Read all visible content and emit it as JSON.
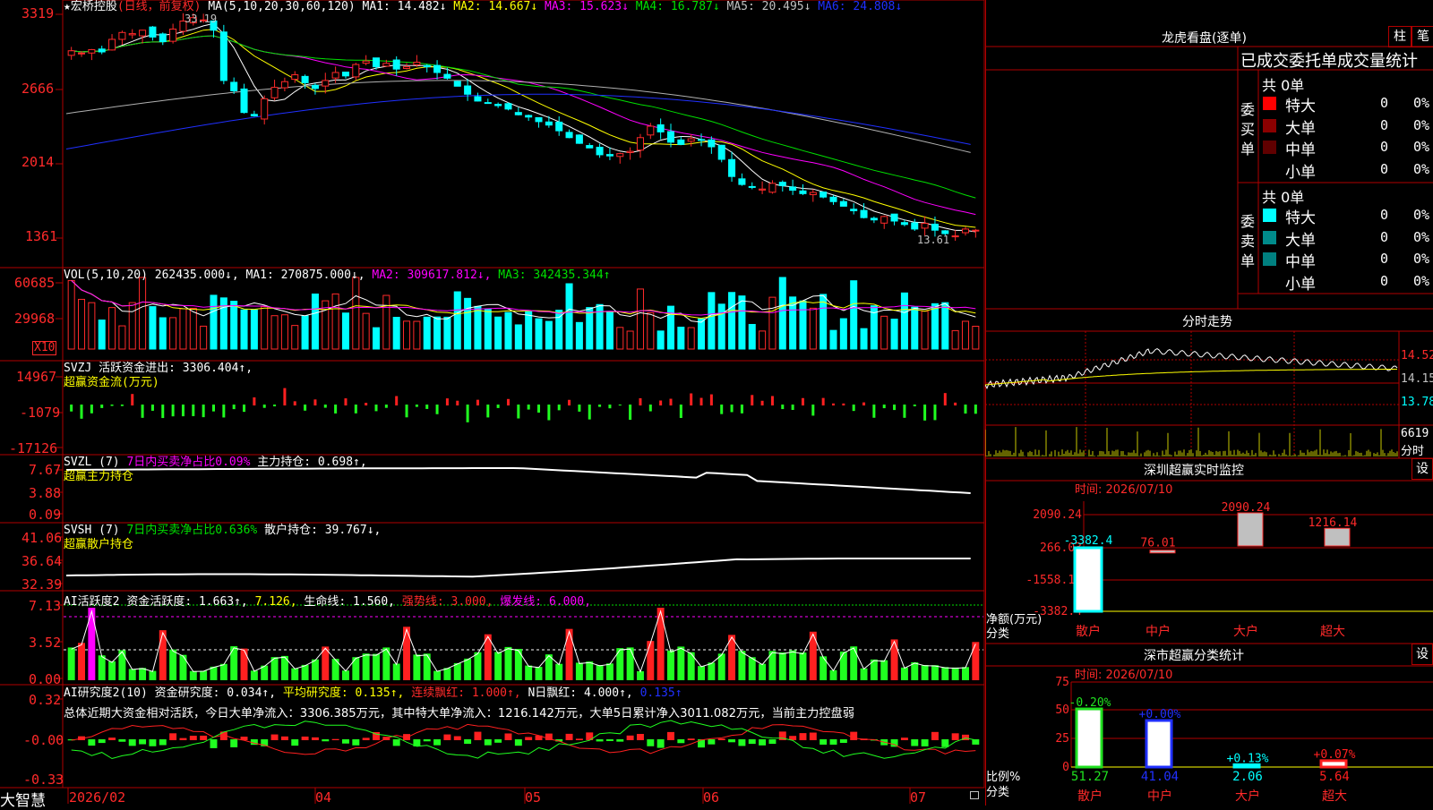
{
  "colors": {
    "up": "#ff2a2a",
    "down": "#00ffff",
    "ma1": "#ffffff",
    "ma2": "#ffff00",
    "ma3": "#ff00ff",
    "ma4": "#00e000",
    "ma5": "#b0b0b0",
    "ma6": "#2030ff",
    "grid": "#b00000",
    "flowUp": "#ff2020",
    "flowDown": "#20ff20"
  },
  "main": {
    "star": "★",
    "name": "宏桥控股",
    "mode": "(日线，前复权)",
    "ma_label": "MA(5,10,20,30,60,120)",
    "ma1": "MA1: 14.482↓",
    "ma2": "MA2: 14.667↓",
    "ma3": "MA3: 15.623↓",
    "ma4": "MA4: 16.787↓",
    "ma5": "MA5: 20.495↓",
    "ma6": "MA6: 24.808↓",
    "high_label": "33.19",
    "low_label": "13.61",
    "yticks": [
      "3319",
      "2666",
      "2014",
      "1361"
    ]
  },
  "vol": {
    "label": "VOL(5,10,20)",
    "value": "262435.000↓,",
    "ma1": "MA1: 270875.000↓,",
    "ma2": "MA2: 309617.812↓,",
    "ma3": "MA3: 342435.344↑",
    "yticks": [
      "60685",
      "29968"
    ],
    "unit": "X10"
  },
  "svzj": {
    "label": "SVZJ",
    "text": "活跃资金进出: 3306.404↑,",
    "sub": "超赢资金流(万元)",
    "yticks": [
      "14967",
      "-1079",
      "-17126"
    ]
  },
  "svzl": {
    "label": "SVZL (7)",
    "a": "7日内买卖净占比0.09%",
    "b": "主力持仓: 0.698↑,",
    "sub": "超赢主力持仓",
    "yticks": [
      "7.67",
      "3.88",
      "0.09"
    ]
  },
  "svsh": {
    "label": "SVSH (7)",
    "a": "7日内买卖净占比0.636%",
    "b": "散户持仓: 39.767↓,",
    "sub": "超赢散户持仓",
    "yticks": [
      "41.06",
      "36.64",
      "32.39"
    ]
  },
  "ai1": {
    "label": "AI活跃度2",
    "a": "资金活跃度: 1.663↑,",
    "b": "7.126,",
    "c": "生命线: 1.560,",
    "d": "强势线: 3.000,",
    "e": "爆发线: 6.000,",
    "yticks": [
      "7.13",
      "3.52",
      "0.00"
    ]
  },
  "ai2": {
    "label": "AI研究度2(10)",
    "a": "资金研究度: 0.034↑,",
    "b": "平均研究度: 0.135↑,",
    "c": "连续飘红: 1.000↑,",
    "d": "N日飘红: 4.000↑,",
    "e": "0.135↑",
    "summary": "总体近期大资金相对活跃，今日大单净流入：3306.385万元，其中特大单净流入：1216.142万元，大单5日累计净入3011.082万元，当前主力控盘弱",
    "yticks": [
      "0.32",
      "-0.00",
      "-0.33"
    ]
  },
  "dates": {
    "brand": "大智慧",
    "labels": [
      "2026/02",
      "04",
      "05",
      "06",
      "07"
    ]
  },
  "right": {
    "lhkp": {
      "title": "龙虎看盘(逐单)",
      "btn1": "柱",
      "btn2": "笔",
      "sub": "已成交委托单成交量统计",
      "buy": {
        "side": "委买单",
        "total": "共 0单",
        "rows": [
          {
            "name": "特大",
            "v": "0",
            "p": "0%",
            "c": "#ff0000"
          },
          {
            "name": "大单",
            "v": "0",
            "p": "0%",
            "c": "#8b0000"
          },
          {
            "name": "中单",
            "v": "0",
            "p": "0%",
            "c": "#600000"
          },
          {
            "name": "小单",
            "v": "0",
            "p": "0%",
            "c": "#000000"
          }
        ]
      },
      "sell": {
        "side": "委卖单",
        "total": "共 0单",
        "rows": [
          {
            "name": "特大",
            "v": "0",
            "p": "0%",
            "c": "#00ffff"
          },
          {
            "name": "大单",
            "v": "0",
            "p": "0%",
            "c": "#008b8b"
          },
          {
            "name": "中单",
            "v": "0",
            "p": "0%",
            "c": "#008080"
          },
          {
            "name": "小单",
            "v": "0",
            "p": "0%",
            "c": "#000000"
          }
        ]
      }
    },
    "fszs": {
      "title": "分时走势",
      "y1": "14.52",
      "y2": "14.15",
      "y3": "13.78",
      "vol": "6619",
      "vlabel": "分时"
    },
    "szcy": {
      "title": "深圳超赢实时监控",
      "btn": "设",
      "time": "时间: 2026/07/10",
      "yticks": [
        "2090.24",
        "266.03",
        "-1558.18",
        "-3382.4"
      ],
      "ylabel1": "净额(万元)",
      "ylabel2": "分类",
      "bars": [
        {
          "name": "散户",
          "value": -3382.4,
          "label": "-3382.4"
        },
        {
          "name": "中户",
          "value": 76.01,
          "label": "76.01"
        },
        {
          "name": "大户",
          "value": 2090.24,
          "label": "2090.24"
        },
        {
          "name": "超大",
          "value": 1216.14,
          "label": "1216.14"
        }
      ]
    },
    "fltj": {
      "title": "深市超赢分类统计",
      "btn": "设",
      "time": "时间: 2026/07/10",
      "yticks": [
        "75",
        "50",
        "25",
        "0"
      ],
      "ylabel1": "比例%",
      "ylabel2": "分类",
      "bars": [
        {
          "name": "散户",
          "value": 51.27,
          "label": "51.27",
          "chg": "-0.20%",
          "c": "#20e020"
        },
        {
          "name": "中户",
          "value": 41.04,
          "label": "41.04",
          "chg": "+0.00%",
          "c": "#2030ff"
        },
        {
          "name": "大户",
          "value": 2.06,
          "label": "2.06",
          "chg": "+0.13%",
          "c": "#00ffff"
        },
        {
          "name": "超大",
          "value": 5.64,
          "label": "5.64",
          "chg": "+0.07%",
          "c": "#ff2020"
        }
      ]
    }
  },
  "chart_data": {
    "type": "candlestick",
    "y_axis_ticks": [
      33.19,
      26.66,
      20.14,
      13.61
    ],
    "x_ticks": [
      "2026/02",
      "04",
      "05",
      "06",
      "07"
    ],
    "series": [
      {
        "name": "MA1",
        "last": 14.482
      },
      {
        "name": "MA2",
        "last": 14.667
      },
      {
        "name": "MA3",
        "last": 15.623
      },
      {
        "name": "MA4",
        "last": 16.787
      },
      {
        "name": "MA5",
        "last": 20.495
      },
      {
        "name": "MA6",
        "last": 24.808
      }
    ],
    "high": 33.19,
    "low": 13.61,
    "close_path": [
      30.0,
      29.8,
      30.1,
      29.9,
      31.0,
      31.6,
      31.5,
      31.8,
      31.2,
      30.8,
      31.9,
      32.6,
      32.9,
      32.7,
      31.8,
      27.4,
      26.5,
      24.6,
      24.3,
      25.8,
      26.8,
      27.3,
      27.9,
      27.2,
      26.7,
      27.4,
      28.1,
      27.8,
      28.8,
      29.1,
      28.6,
      28.9,
      28.4,
      28.6,
      29.0,
      28.6,
      28.1,
      27.6,
      26.9,
      26.2,
      25.6,
      25.4,
      25.2,
      24.9,
      24.4,
      24.2,
      23.8,
      23.5,
      23.0,
      22.4,
      21.9,
      21.5,
      20.9,
      20.8,
      21.0,
      21.2,
      22.4,
      23.4,
      22.9,
      22.0,
      21.8,
      22.3,
      22.2,
      21.6,
      20.5,
      19.0,
      18.3,
      18.1,
      17.9,
      18.4,
      18.2,
      17.8,
      17.5,
      17.6,
      17.2,
      16.8,
      16.4,
      16.0,
      15.4,
      15.2,
      15.5,
      15.1,
      14.8,
      14.4,
      14.9,
      14.3,
      14.0,
      13.8,
      14.4,
      14.3
    ]
  }
}
